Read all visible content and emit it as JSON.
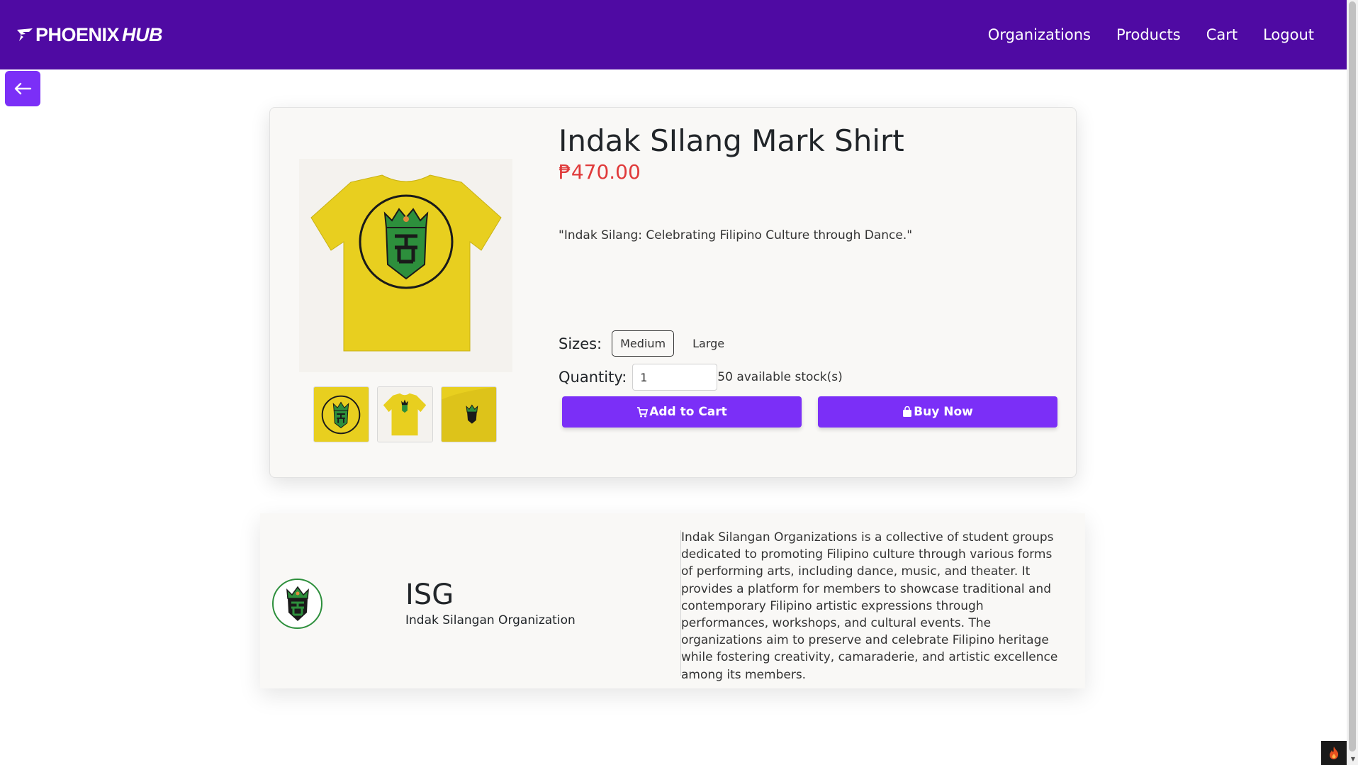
{
  "navbar": {
    "brand_main": "PHOENIX",
    "brand_accent": "HUB",
    "links": [
      "Organizations",
      "Products",
      "Cart",
      "Logout"
    ]
  },
  "product": {
    "title": "Indak SIlang Mark Shirt",
    "price": "₱470.00",
    "description": "\"Indak Silang: Celebrating Filipino Culture through Dance.\"",
    "sizes_label": "Sizes:",
    "sizes": [
      "Medium",
      "Large"
    ],
    "selected_size": "Medium",
    "quantity_label": "Quantity:",
    "quantity_value": "1",
    "stock_text": "50 available stock(s)",
    "add_to_cart_label": "Add to Cart",
    "buy_now_label": "Buy Now"
  },
  "organization": {
    "acronym": "ISG",
    "name": "Indak Silangan Organization",
    "description": "Indak Silangan Organizations is a collective of student groups dedicated to promoting Filipino culture through various forms of performing arts, including dance, music, and theater. It provides a platform for members to showcase traditional and contemporary Filipino artistic expressions through performances, workshops, and cultural events. The organizations aim to preserve and celebrate Filipino heritage while fostering creativity, camaraderie, and artistic excellence among its members."
  },
  "colors": {
    "navbar_bg": "#4f0aa3",
    "accent": "#7b2ff7",
    "price": "#e03a3a",
    "shirt_yellow": "#e8cf1f",
    "logo_green": "#2d8f3c"
  },
  "icons": [
    "phoenix-wing-icon",
    "arrow-left-icon",
    "cart-icon",
    "shopping-bag-icon",
    "fire-icon"
  ]
}
